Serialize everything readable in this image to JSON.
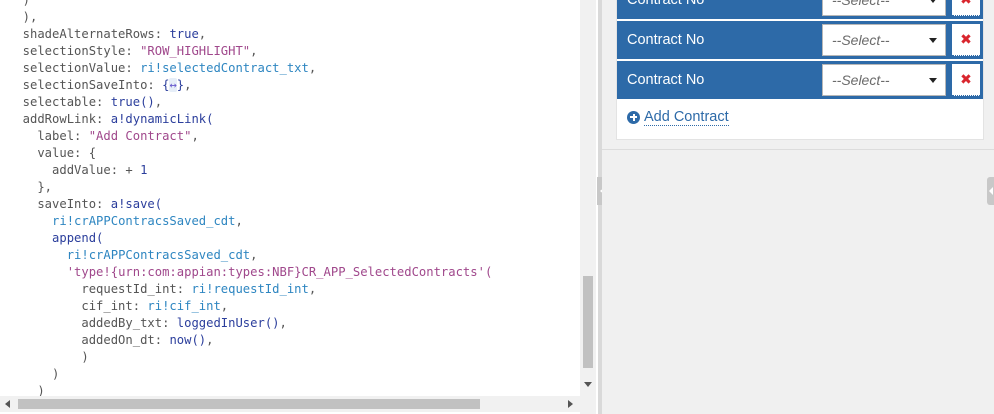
{
  "editor": {
    "lines": [
      [
        {
          "t": "  )",
          "c": "plain"
        }
      ],
      [
        {
          "t": "  ),",
          "c": "plain"
        }
      ],
      [
        {
          "t": "  shadeAlternateRows: ",
          "c": "plain"
        },
        {
          "t": "true",
          "c": "kw"
        },
        {
          "t": ",",
          "c": "plain"
        }
      ],
      [
        {
          "t": "  selectionStyle: ",
          "c": "plain"
        },
        {
          "t": "\"ROW_HIGHLIGHT\"",
          "c": "str"
        },
        {
          "t": ",",
          "c": "plain"
        }
      ],
      [
        {
          "t": "  selectionValue: ",
          "c": "plain"
        },
        {
          "t": "ri!selectedContract_txt",
          "c": "rule"
        },
        {
          "t": ",",
          "c": "plain"
        }
      ],
      [
        {
          "t": "  selectionSaveInto: ",
          "c": "plain"
        },
        {
          "t": "{",
          "c": "brace"
        },
        {
          "t": "↔",
          "c": "mark"
        },
        {
          "t": "}",
          "c": "brace"
        },
        {
          "t": ",",
          "c": "plain"
        }
      ],
      [
        {
          "t": "  selectable: ",
          "c": "plain"
        },
        {
          "t": "true()",
          "c": "fn"
        },
        {
          "t": ",",
          "c": "plain"
        }
      ],
      [
        {
          "t": "  addRowLink: ",
          "c": "plain"
        },
        {
          "t": "a!dynamicLink(",
          "c": "fn"
        }
      ],
      [
        {
          "t": "    label: ",
          "c": "plain"
        },
        {
          "t": "\"Add Contract\"",
          "c": "str"
        },
        {
          "t": ",",
          "c": "plain"
        }
      ],
      [
        {
          "t": "    value: {",
          "c": "plain"
        }
      ],
      [
        {
          "t": "      addValue: + ",
          "c": "plain"
        },
        {
          "t": "1",
          "c": "num"
        }
      ],
      [
        {
          "t": "    },",
          "c": "plain"
        }
      ],
      [
        {
          "t": "    saveInto: ",
          "c": "plain"
        },
        {
          "t": "a!save(",
          "c": "fn"
        }
      ],
      [
        {
          "t": "      ",
          "c": "plain"
        },
        {
          "t": "ri!crAPPContracsSaved_cdt",
          "c": "rule"
        },
        {
          "t": ",",
          "c": "plain"
        }
      ],
      [
        {
          "t": "      ",
          "c": "plain"
        },
        {
          "t": "append(",
          "c": "fn"
        }
      ],
      [
        {
          "t": "        ",
          "c": "plain"
        },
        {
          "t": "ri!crAPPContracsSaved_cdt",
          "c": "rule"
        },
        {
          "t": ",",
          "c": "plain"
        }
      ],
      [
        {
          "t": "        ",
          "c": "plain"
        },
        {
          "t": "'type!{urn:com:appian:types:NBF}CR_APP_SelectedContracts'(",
          "c": "str"
        }
      ],
      [
        {
          "t": "          requestId_int: ",
          "c": "plain"
        },
        {
          "t": "ri!requestId_int",
          "c": "rule"
        },
        {
          "t": ",",
          "c": "plain"
        }
      ],
      [
        {
          "t": "          cif_int: ",
          "c": "plain"
        },
        {
          "t": "ri!cif_int",
          "c": "rule"
        },
        {
          "t": ",",
          "c": "plain"
        }
      ],
      [
        {
          "t": "          addedBy_txt: ",
          "c": "plain"
        },
        {
          "t": "loggedInUser()",
          "c": "fn"
        },
        {
          "t": ",",
          "c": "plain"
        }
      ],
      [
        {
          "t": "          addedOn_dt: ",
          "c": "plain"
        },
        {
          "t": "now()",
          "c": "fn"
        },
        {
          "t": ",",
          "c": "plain"
        }
      ],
      [
        {
          "t": "          )",
          "c": "plain"
        }
      ],
      [
        {
          "t": "      )",
          "c": "plain"
        }
      ],
      [
        {
          "t": "    )",
          "c": "plain"
        }
      ]
    ]
  },
  "preview": {
    "rows": [
      {
        "label": "Contract No",
        "select": "--Select--",
        "delete": "✖"
      },
      {
        "label": "Contract No",
        "select": "--Select--",
        "delete": "✖"
      },
      {
        "label": "Contract No",
        "select": "--Select--",
        "delete": "✖"
      }
    ],
    "add_link_label": "Add Contract",
    "colors": {
      "header_blue": "#2d6aa8",
      "delete_red": "#d9262e",
      "link_blue": "#2d6aa8"
    }
  }
}
